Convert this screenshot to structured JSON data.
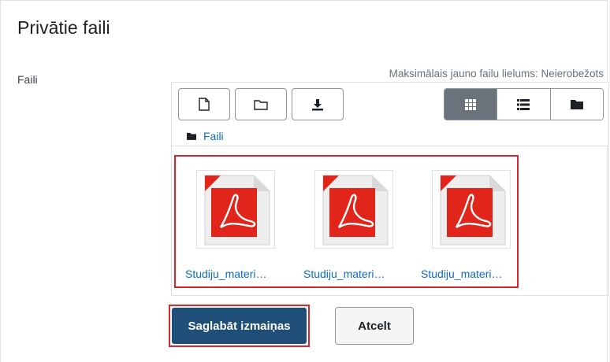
{
  "page": {
    "title": "Privātie faili"
  },
  "field": {
    "label": "Faili",
    "max_size": "Maksimālais jauno failu lielums: Neierobežots"
  },
  "toolbar": {
    "add_file_icon": "file-icon",
    "create_folder_icon": "folder-icon",
    "download_icon": "download-icon",
    "views": [
      {
        "icon": "grid-icon",
        "active": true
      },
      {
        "icon": "list-icon",
        "active": false
      },
      {
        "icon": "tree-folder-icon",
        "active": false
      }
    ]
  },
  "path": {
    "label": "Faili"
  },
  "files": [
    {
      "name": "Studiju_materi…",
      "icon": "pdf-icon"
    },
    {
      "name": "Studiju_materi…",
      "icon": "pdf-icon"
    },
    {
      "name": "Studiju_materi…",
      "icon": "pdf-icon"
    }
  ],
  "actions": {
    "save_label": "Saglabāt izmaiņas",
    "cancel_label": "Atcelt"
  },
  "colors": {
    "primary": "#1f4e79",
    "link": "#0f6cbf",
    "highlight": "#d9262e",
    "pdf_red": "#e1251b"
  }
}
